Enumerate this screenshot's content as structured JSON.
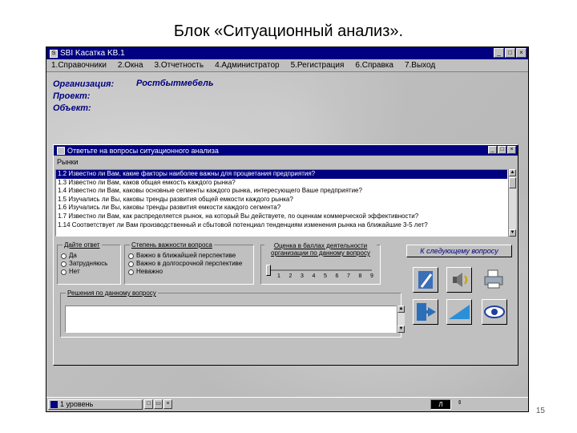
{
  "slide": {
    "title": "Блок «Ситуационный анализ».",
    "page_number": "15"
  },
  "app": {
    "title": "SBI Kaсатка KB.1",
    "menu": [
      "1.Справочники",
      "2.Окна",
      "3.Отчетность",
      "4.Администратор",
      "5.Регистрация",
      "6.Справка",
      "7.Выход"
    ]
  },
  "header": {
    "organization_label": "Организация:",
    "organization_value": "Ростбытмебель",
    "project_label": "Проект:",
    "object_label": "Объект:"
  },
  "dialog": {
    "title": "Ответьте на вопросы ситуационного анализа",
    "section": "Рынки",
    "questions": [
      "1.2 Известно ли Вам, какие факторы наиболее важны для процветания предприятия?",
      "1.3 Известно ли Вам, каков общая емкость каждого рынка?",
      "1.4 Известно ли Вам, каковы основные сегменты каждого рынка, интересующего Ваше предприятие?",
      "1.5 Изучались ли Вы, каковы тренды развития общей емкости каждого рынка?",
      "1.6 Изучались ли Вы, каковы тренды развития емкости каждого сегмента?",
      "1.7 Известно ли Вам, как распределяется рынок, на который Вы действуете, по оценкам коммерческой эффективности?",
      "1.14 Соответствует ли Вам производственный и сбытовой потенциал тенденциям изменения рынка на ближайшие 3-5 лет?"
    ],
    "answer_group": {
      "title": "Дайте ответ",
      "options": [
        "Да",
        "Затрудняюсь",
        "Нет"
      ]
    },
    "importance_group": {
      "title": "Степень важности вопроса",
      "options": [
        "Важно в ближайшей перспективе",
        "Важно в долгосрочной перспективе",
        "Неважно"
      ]
    },
    "score_group": {
      "title": "Оценка в баллах деятельности организации по данному вопросу",
      "ticks": [
        "1",
        "2",
        "3",
        "4",
        "5",
        "6",
        "7",
        "8",
        "9"
      ]
    },
    "next_button": "К следующему вопросу",
    "solution_label": "Решения по данному вопросу"
  },
  "taskbar": {
    "item": "1 уровень",
    "tray": "Л"
  }
}
